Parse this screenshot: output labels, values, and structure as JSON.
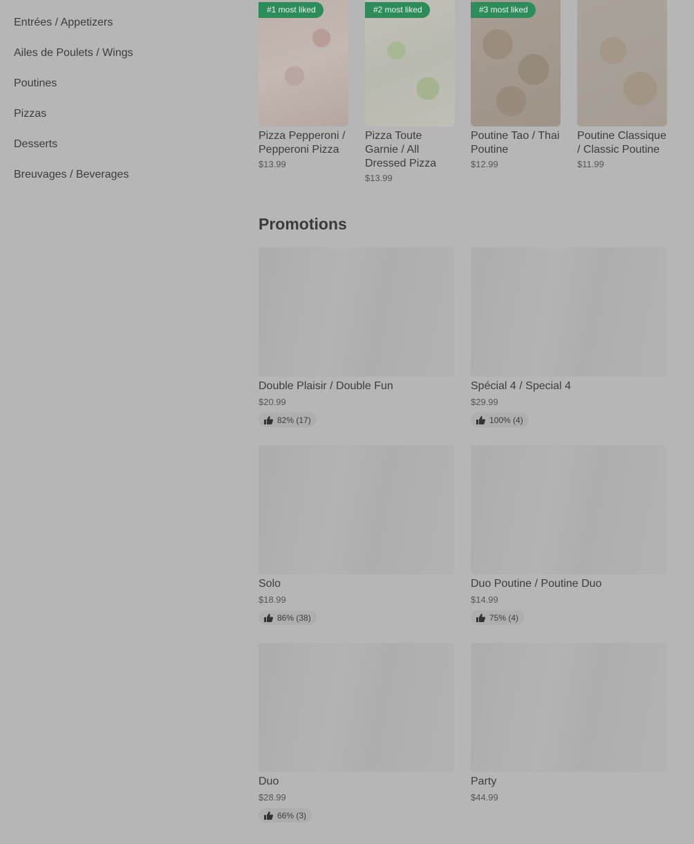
{
  "sidebar": {
    "categories": [
      "Entrées / Appetizers",
      "Ailes de Poulets / Wings",
      "Poutines",
      "Pizzas",
      "Desserts",
      "Breuvages / Beverages"
    ]
  },
  "most_liked": [
    {
      "badge": "#1 most liked",
      "name": "Pizza Pepperoni / Pepperoni Pizza",
      "price": "$13.99"
    },
    {
      "badge": "#2 most liked",
      "name": "Pizza Toute Garnie / All Dressed Pizza",
      "price": "$13.99"
    },
    {
      "badge": "#3 most liked",
      "name": "Poutine Tao  / Thai Poutine",
      "price": "$12.99"
    },
    {
      "badge": "",
      "name": "Poutine Classique / Classic Poutine",
      "price": "$11.99"
    }
  ],
  "promotions": {
    "title": "Promotions",
    "items": [
      {
        "name": "Double Plaisir / Double Fun",
        "price": "$20.99",
        "rating": "82% (17)"
      },
      {
        "name": "Spécial 4 / Special 4",
        "price": "$29.99",
        "rating": "100% (4)"
      },
      {
        "name": "Solo",
        "price": "$18.99",
        "rating": "86% (38)"
      },
      {
        "name": "Duo Poutine / Poutine Duo",
        "price": "$14.99",
        "rating": "75% (4)"
      },
      {
        "name": "Duo",
        "price": "$28.99",
        "rating": "66% (3)"
      },
      {
        "name": "Party",
        "price": "$44.99",
        "rating": ""
      }
    ]
  },
  "icons": {
    "rating": "thumbs-up-icon"
  },
  "colors": {
    "badge": "#2e8b5a",
    "background": "#b6b6b6"
  }
}
